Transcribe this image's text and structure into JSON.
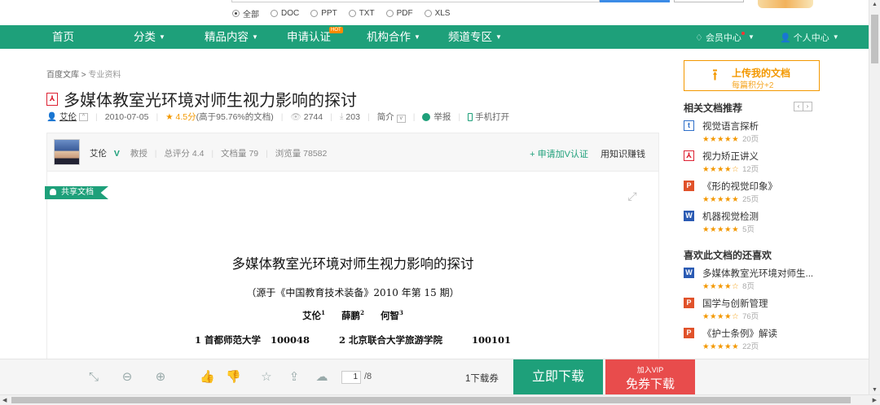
{
  "search": {
    "filters": [
      {
        "label": "全部",
        "selected": true
      },
      {
        "label": "DOC",
        "selected": false
      },
      {
        "label": "PPT",
        "selected": false
      },
      {
        "label": "TXT",
        "selected": false
      },
      {
        "label": "PDF",
        "selected": false
      },
      {
        "label": "XLS",
        "selected": false
      }
    ]
  },
  "nav": {
    "home": "首页",
    "category": "分类",
    "featured": "精品内容",
    "certify": "申请认证",
    "certify_badge": "HOT",
    "partner": "机构合作",
    "channel": "频道专区",
    "member_center": "会员中心",
    "personal_center": "个人中心"
  },
  "breadcrumb": {
    "root": "百度文库",
    "separator": ">",
    "current": "专业资料"
  },
  "document": {
    "title": "多媒体教室光环境对师生视力影响的探讨",
    "author": "艾伦",
    "date": "2010-07-05",
    "rating": "4.5分",
    "rating_note": "(高于95.76%的文档)",
    "views": "2744",
    "downloads": "203",
    "intro_label": "简介",
    "report": "举报",
    "mobile_open": "手机打开"
  },
  "author_box": {
    "name": "艾伦",
    "verified": "V",
    "role": "教授",
    "total_score": "总评分 4.4",
    "doc_count": "文档量 79",
    "view_count": "浏览量 78582",
    "apply_v": "+ 申请加V认证",
    "earn": "用知识赚钱"
  },
  "share_tag": "共享文档",
  "content": {
    "title": "多媒体教室光环境对师生视力影响的探讨",
    "source": "（源于《中国教育技术装备》2010 年第 15 期）",
    "authors": [
      {
        "name": "艾伦",
        "sup": "1"
      },
      {
        "name": "薛鹏",
        "sup": "2"
      },
      {
        "name": "何智",
        "sup": "3"
      }
    ],
    "affiliations": "1 首都师范大学   100048         2 北京联合大学旅游学院         100101"
  },
  "upload": {
    "label": "上传我的文档",
    "sub": "每篇积分+2"
  },
  "related": {
    "heading": "相关文档推荐",
    "items": [
      {
        "icon": "t",
        "title": "视觉语言探析",
        "stars": "★★★★★",
        "pages": "20页"
      },
      {
        "icon": "pdf",
        "title": "视力矫正讲义",
        "stars": "★★★★☆",
        "pages": "12页"
      },
      {
        "icon": "p",
        "title": "《形的视觉印象》",
        "stars": "★★★★★",
        "pages": "25页"
      },
      {
        "icon": "w",
        "title": "机器视觉检测",
        "stars": "★★★★★",
        "pages": "5页"
      }
    ]
  },
  "also_like": {
    "heading": "喜欢此文档的还喜欢",
    "items": [
      {
        "icon": "w",
        "title": "多媒体教室光环境对师生...",
        "stars": "★★★★☆",
        "pages": "8页"
      },
      {
        "icon": "p",
        "title": "国学与创新管理",
        "stars": "★★★★☆",
        "pages": "76页"
      },
      {
        "icon": "p",
        "title": "《护士条例》解读",
        "stars": "★★★★★",
        "pages": "22页"
      }
    ]
  },
  "toolbar": {
    "page_current": "1",
    "page_total": "/8",
    "coupon": "1下载券",
    "download": "立即下载",
    "vip_small": "加入VIP",
    "vip_big": "免券下载"
  },
  "colors": {
    "brand_green": "#1ea07a",
    "accent_orange": "#f39800",
    "vip_red": "#e84c4c"
  }
}
